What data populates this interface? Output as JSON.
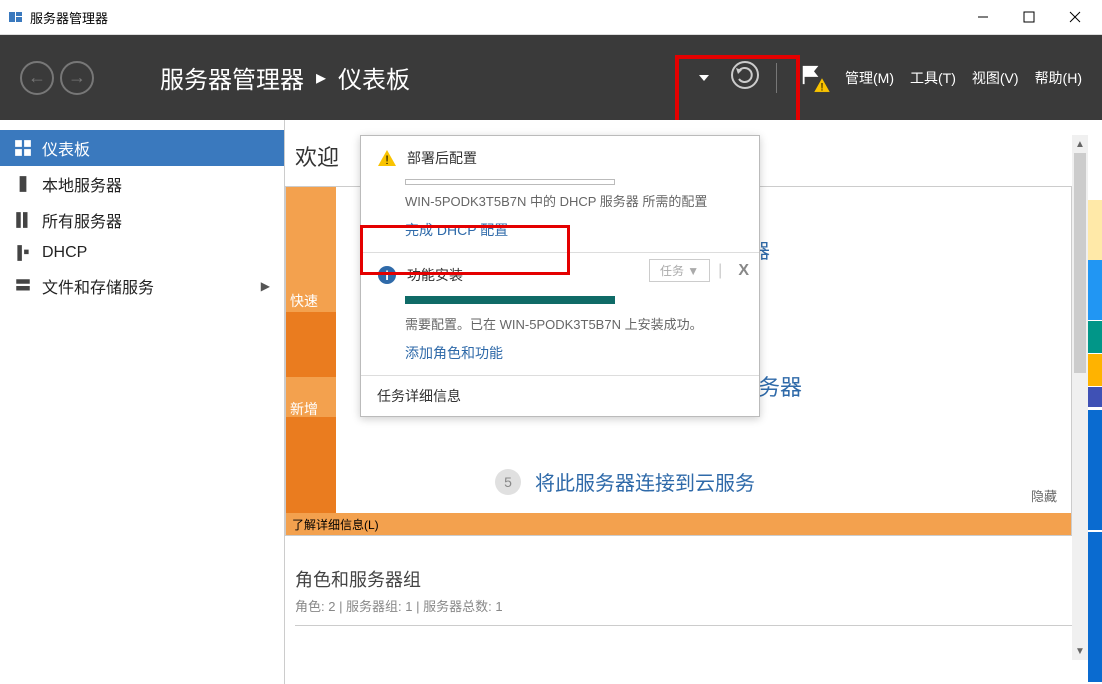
{
  "titlebar": {
    "title": "服务器管理器"
  },
  "header": {
    "breadcrumb_root": "服务器管理器",
    "breadcrumb_leaf": "仪表板",
    "menu_manage": "管理(M)",
    "menu_tools": "工具(T)",
    "menu_view": "视图(V)",
    "menu_help": "帮助(H)"
  },
  "sidebar": {
    "items": [
      {
        "label": "仪表板",
        "icon": "dashboard"
      },
      {
        "label": "本地服务器",
        "icon": "server"
      },
      {
        "label": "所有服务器",
        "icon": "servers"
      },
      {
        "label": "DHCP",
        "icon": "dhcp"
      },
      {
        "label": "文件和存储服务",
        "icon": "storage",
        "expandable": true
      }
    ]
  },
  "main": {
    "welcome_prefix": "欢迎",
    "quick": "快速",
    "new": "新增",
    "partial_text1": "器",
    "partial_text2": "服务器",
    "step5_num": "5",
    "step5_text": "将此服务器连接到云服务",
    "hide": "隐藏",
    "learn_more": "了解详细信息(L)",
    "roles_title": "角色和服务器组",
    "roles_sub": "角色: 2 | 服务器组: 1 | 服务器总数: 1"
  },
  "popup": {
    "section1": {
      "title": "部署后配置",
      "desc": "WIN-5PODK3T5B7N 中的 DHCP 服务器 所需的配置",
      "link": "完成 DHCP 配置"
    },
    "section2": {
      "title": "功能安装",
      "desc": "需要配置。已在 WIN-5PODK3T5B7N 上安装成功。",
      "link": "添加角色和功能",
      "task_btn": "任务 ▼",
      "close": "X"
    },
    "details": "任务详细信息"
  }
}
